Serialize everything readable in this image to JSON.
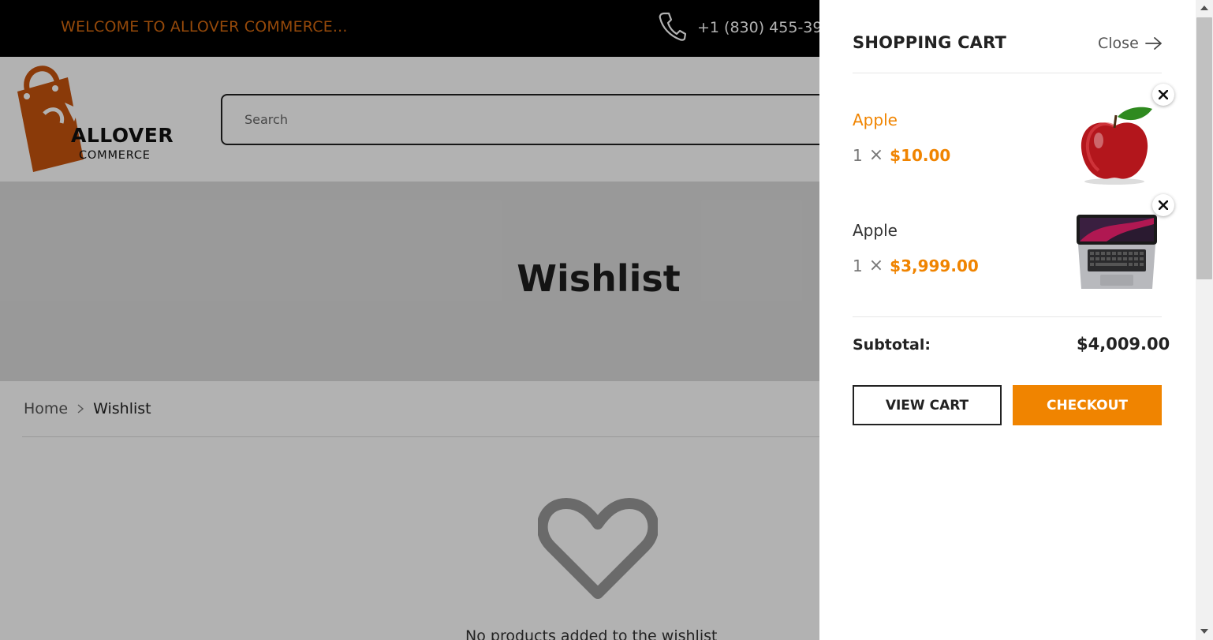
{
  "topbar": {
    "welcome": "WELCOME TO ALLOVER COMMERCE...",
    "phone": "+1 (830) 455-39"
  },
  "logo": {
    "word1": "ALLOVER",
    "word2": "COMMERCE"
  },
  "search": {
    "placeholder": "Search"
  },
  "banner": {
    "title": "Wishlist"
  },
  "breadcrumb": {
    "home": "Home",
    "current": "Wishlist"
  },
  "empty_state": {
    "text": "No products added to the wishlist"
  },
  "cart": {
    "title": "SHOPPING CART",
    "close_label": "Close",
    "items": [
      {
        "name": "Apple",
        "qty": "1",
        "times": "×",
        "price": "$10.00",
        "image": "red-apple",
        "name_color": "#f08400"
      },
      {
        "name": "Apple",
        "qty": "1",
        "times": "×",
        "price": "$3,999.00",
        "image": "macbook-laptop",
        "name_color": "#333333"
      }
    ],
    "subtotal_label": "Subtotal:",
    "subtotal_value": "$4,009.00",
    "view_cart_label": "VIEW CART",
    "checkout_label": "CHECKOUT"
  },
  "colors": {
    "accent": "#f08400",
    "brand": "#d6690f",
    "topbar": "#000000"
  }
}
